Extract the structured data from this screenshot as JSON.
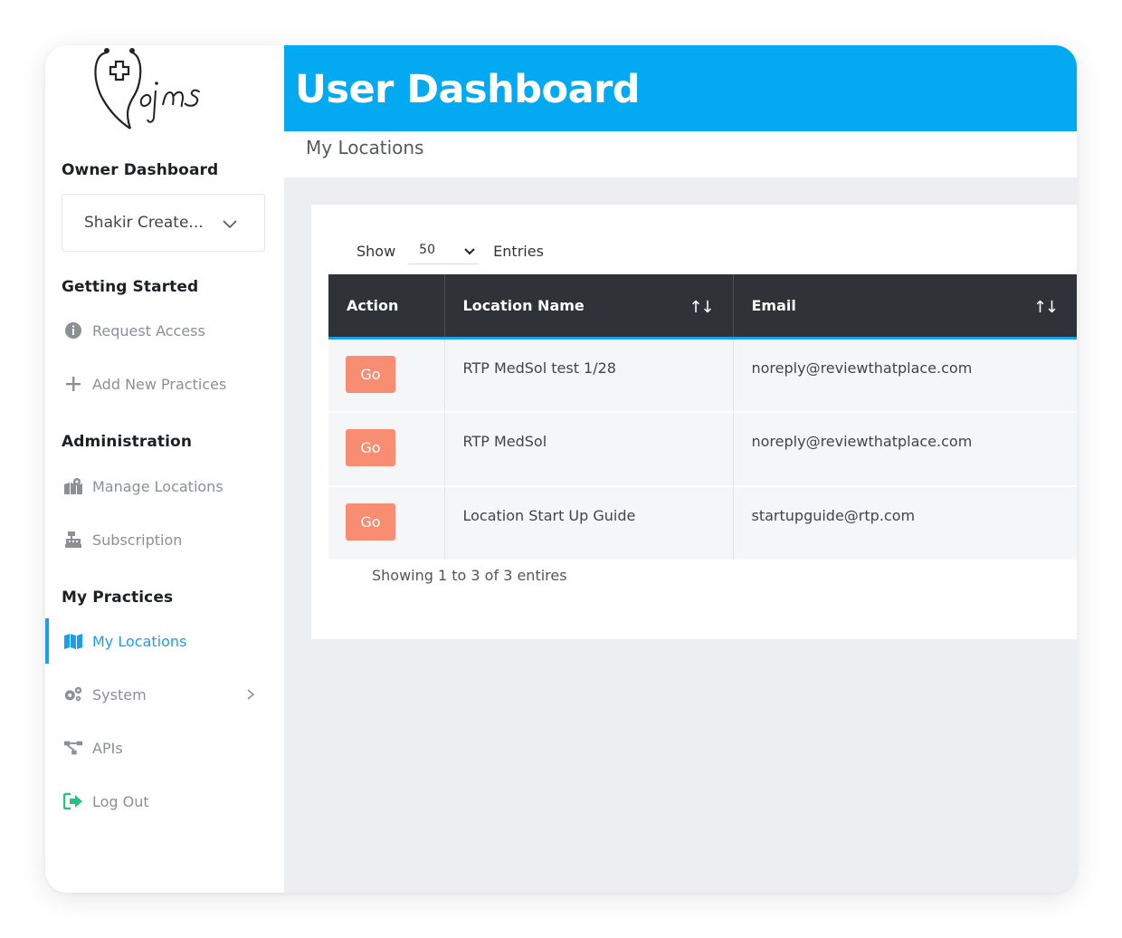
{
  "sidebar": {
    "owner_title": "Owner Dashboard",
    "selected_owner": "Shakir Create...",
    "getting_started_title": "Getting Started",
    "getting_started_items": [
      {
        "label": "Request Access",
        "icon": "info-circle-icon"
      },
      {
        "label": "Add New Practices",
        "icon": "plus-icon"
      }
    ],
    "administration_title": "Administration",
    "administration_items": [
      {
        "label": "Manage Locations",
        "icon": "map-marker-icon"
      },
      {
        "label": "Subscription",
        "icon": "cash-register-icon"
      }
    ],
    "my_practices_title": "My Practices",
    "my_practices_items": [
      {
        "label": "My Locations",
        "icon": "map-icon",
        "active": true
      },
      {
        "label": "System",
        "icon": "gears-icon"
      },
      {
        "label": "APIs",
        "icon": "sitemap-icon"
      },
      {
        "label": "Log Out",
        "icon": "sign-out-icon"
      }
    ]
  },
  "header": {
    "title": "User Dashboard",
    "breadcrumb": "My Locations"
  },
  "table_controls": {
    "show_label": "Show",
    "entries_value": "50",
    "entries_label": "Entries"
  },
  "table": {
    "columns": [
      "Action",
      "Location Name",
      "Email"
    ],
    "sort_symbol": "↑↓",
    "rows": [
      {
        "action": "Go",
        "location": "RTP MedSol test 1/28",
        "email": "noreply@reviewthatplace.com"
      },
      {
        "action": "Go",
        "location": "RTP MedSol",
        "email": "noreply@reviewthatplace.com"
      },
      {
        "action": "Go",
        "location": "Location Start Up Guide",
        "email": "startupguide@rtp.com"
      }
    ],
    "footer": "Showing 1 to 3 of 3 entires"
  },
  "colors": {
    "brand_blue": "#03a9f1",
    "active_blue": "#1a9fe8",
    "go_button": "#f98d71",
    "table_header": "#2f3337"
  }
}
